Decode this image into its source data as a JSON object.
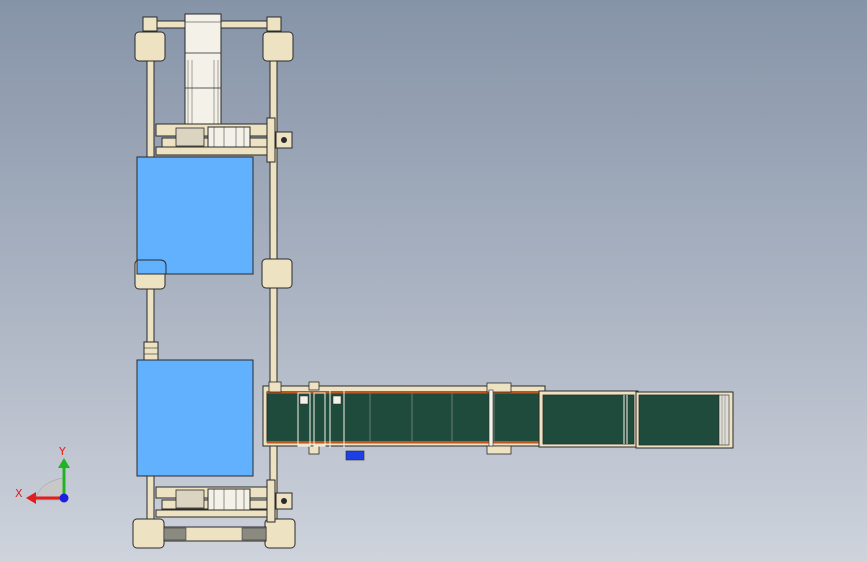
{
  "colors": {
    "background_top": "#8694a8",
    "background_bottom": "#ced3dc",
    "frame_beige": "#ede3c3",
    "frame_outline": "#2a2a2a",
    "box_blue": "#62b1ff",
    "belt_dark_green": "#1f4b3c",
    "belt_orange_edge": "#c0561e",
    "x_axis_red": "#e01e1e",
    "y_axis_green": "#22b322",
    "origin_blue": "#1f1fe0",
    "sensor_blue": "#1f3fe6"
  },
  "icons": {
    "triad": "xyz-axis-triad-icon"
  },
  "triad": {
    "x_label": "X",
    "y_label": "Y"
  }
}
